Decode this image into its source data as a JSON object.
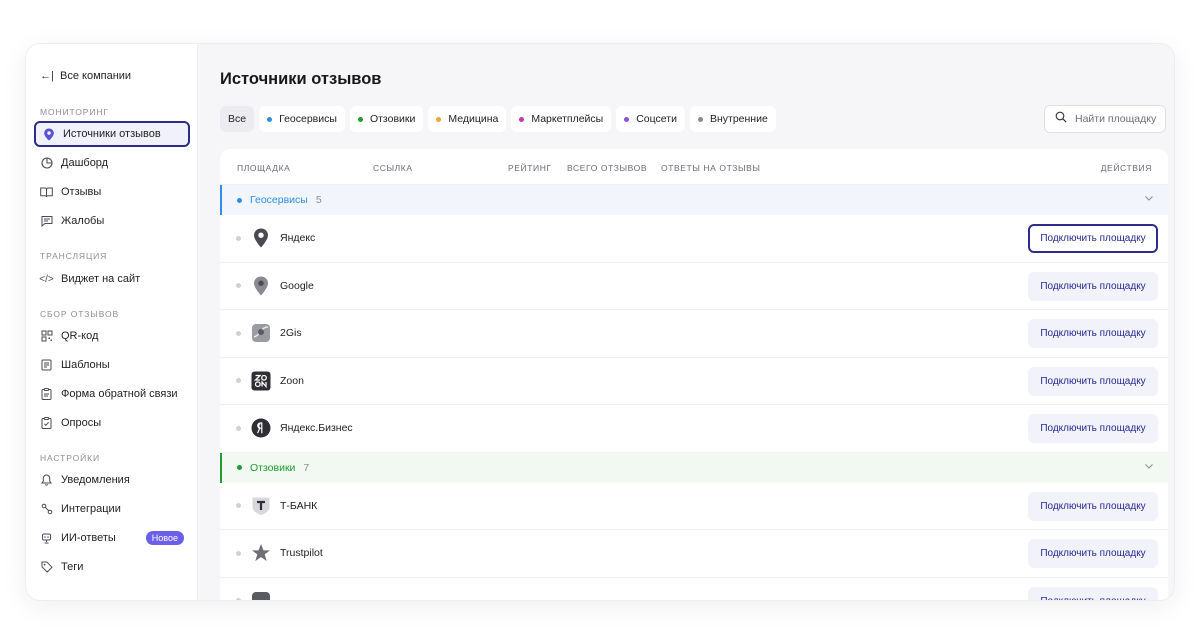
{
  "sidebar": {
    "back_label": "Все компании",
    "sections": {
      "monitoring": "Мониторинг",
      "translation": "Трансляция",
      "collection": "Сбор отзывов",
      "settings": "Настройки"
    },
    "items": {
      "sources": "Источники отзывов",
      "dashboard": "Дашборд",
      "reviews": "Отзывы",
      "complaints": "Жалобы",
      "widget": "Виджет на сайт",
      "qr": "QR-код",
      "templates": "Шаблоны",
      "feedback_form": "Форма обратной связи",
      "polls": "Опросы",
      "notifications": "Уведомления",
      "integrations": "Интеграции",
      "ai_answers": "ИИ-ответы",
      "tags": "Теги"
    },
    "new_badge": "Новое"
  },
  "main": {
    "title": "Источники отзывов",
    "filters": {
      "all": "Все",
      "geo": "Геосервисы",
      "otzoviki": "Отзовики",
      "medicine": "Медицина",
      "marketplaces": "Маркетплейсы",
      "social": "Соцсети",
      "internal": "Внутренние"
    },
    "search_placeholder": "Найти площадку",
    "columns": {
      "platform": "Площадка",
      "link": "Ссылка",
      "rating": "Рейтинг",
      "total": "Всего отзывов",
      "answers": "Ответы на отзывы",
      "actions": "Действия"
    },
    "groups": {
      "geo": {
        "name": "Геосервисы",
        "count": "5"
      },
      "otzoviki": {
        "name": "Отзовики",
        "count": "7"
      }
    },
    "rows": {
      "yandex": "Яндекс",
      "google": "Google",
      "twogis": "2Gis",
      "zoon": "Zoon",
      "yandex_business": "Яндекс.Бизнес",
      "tbank": "Т-БАНК",
      "trustpilot": "Trustpilot"
    },
    "connect_label": "Подключить площадку"
  },
  "colors": {
    "accent": "#2c2c8a",
    "geo": "#2f8de4",
    "otzoviki": "#1f9d2e",
    "medicine": "#f0a23b",
    "marketplaces": "#c23aa8",
    "social": "#8c4fe0",
    "internal": "#8a8a94",
    "badge": "#6b5fe8"
  }
}
